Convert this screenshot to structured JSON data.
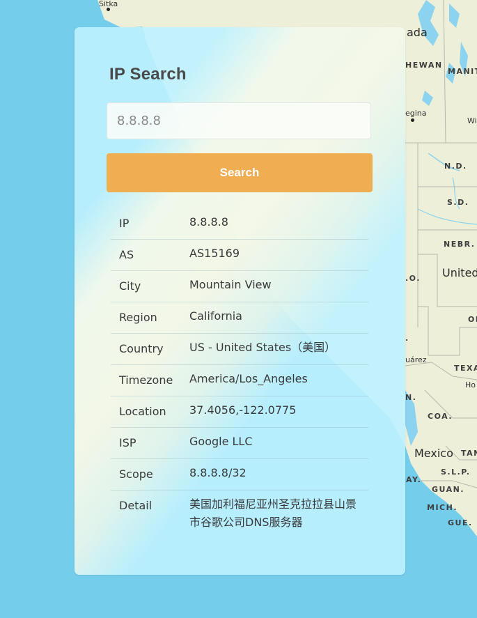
{
  "map": {
    "labels": {
      "sitka": "Sitka",
      "canada": "ada",
      "saskatchewan": "HEWAN",
      "manitoba": "MANIT",
      "regina": "egina",
      "wi": "Wi",
      "nd": "N.D.",
      "sd": "S.D.",
      "nebr": "NEBR.",
      "united": "United",
      "colo": ".O.",
      "ok": "OK",
      "juarez": "uárez",
      "texas": "TEXA",
      "ho": "Ho",
      "a_mark": ".",
      "n_mark": "N.",
      "coa": "COA.",
      "mexico": "Mexico",
      "tam": "TAN",
      "slp": "S.L.P.",
      "ay": "AY.",
      "guan": "GUAN.",
      "mich": "MICH.",
      "gue": "GUE."
    }
  },
  "app": {
    "title": "IP Search"
  },
  "search": {
    "value": "",
    "placeholder": "8.8.8.8",
    "button_label": "Search"
  },
  "results": [
    {
      "key": "IP",
      "value": "8.8.8.8"
    },
    {
      "key": "AS",
      "value": "AS15169"
    },
    {
      "key": "City",
      "value": "Mountain View"
    },
    {
      "key": "Region",
      "value": "California"
    },
    {
      "key": "Country",
      "value": "US - United States（美国）"
    },
    {
      "key": "Timezone",
      "value": "America/Los_Angeles"
    },
    {
      "key": "Location",
      "value": "37.4056,-122.0775"
    },
    {
      "key": "ISP",
      "value": "Google LLC"
    },
    {
      "key": "Scope",
      "value": "8.8.8.8/32"
    },
    {
      "key": "Detail",
      "value": "美国加利福尼亚州圣克拉拉县山景市谷歌公司DNS服务器"
    }
  ],
  "colors": {
    "ocean": "#74cdea",
    "land": "#eeefd9",
    "card": "#bef2ff",
    "button": "#f0ae52",
    "text": "#3a3a3a"
  }
}
